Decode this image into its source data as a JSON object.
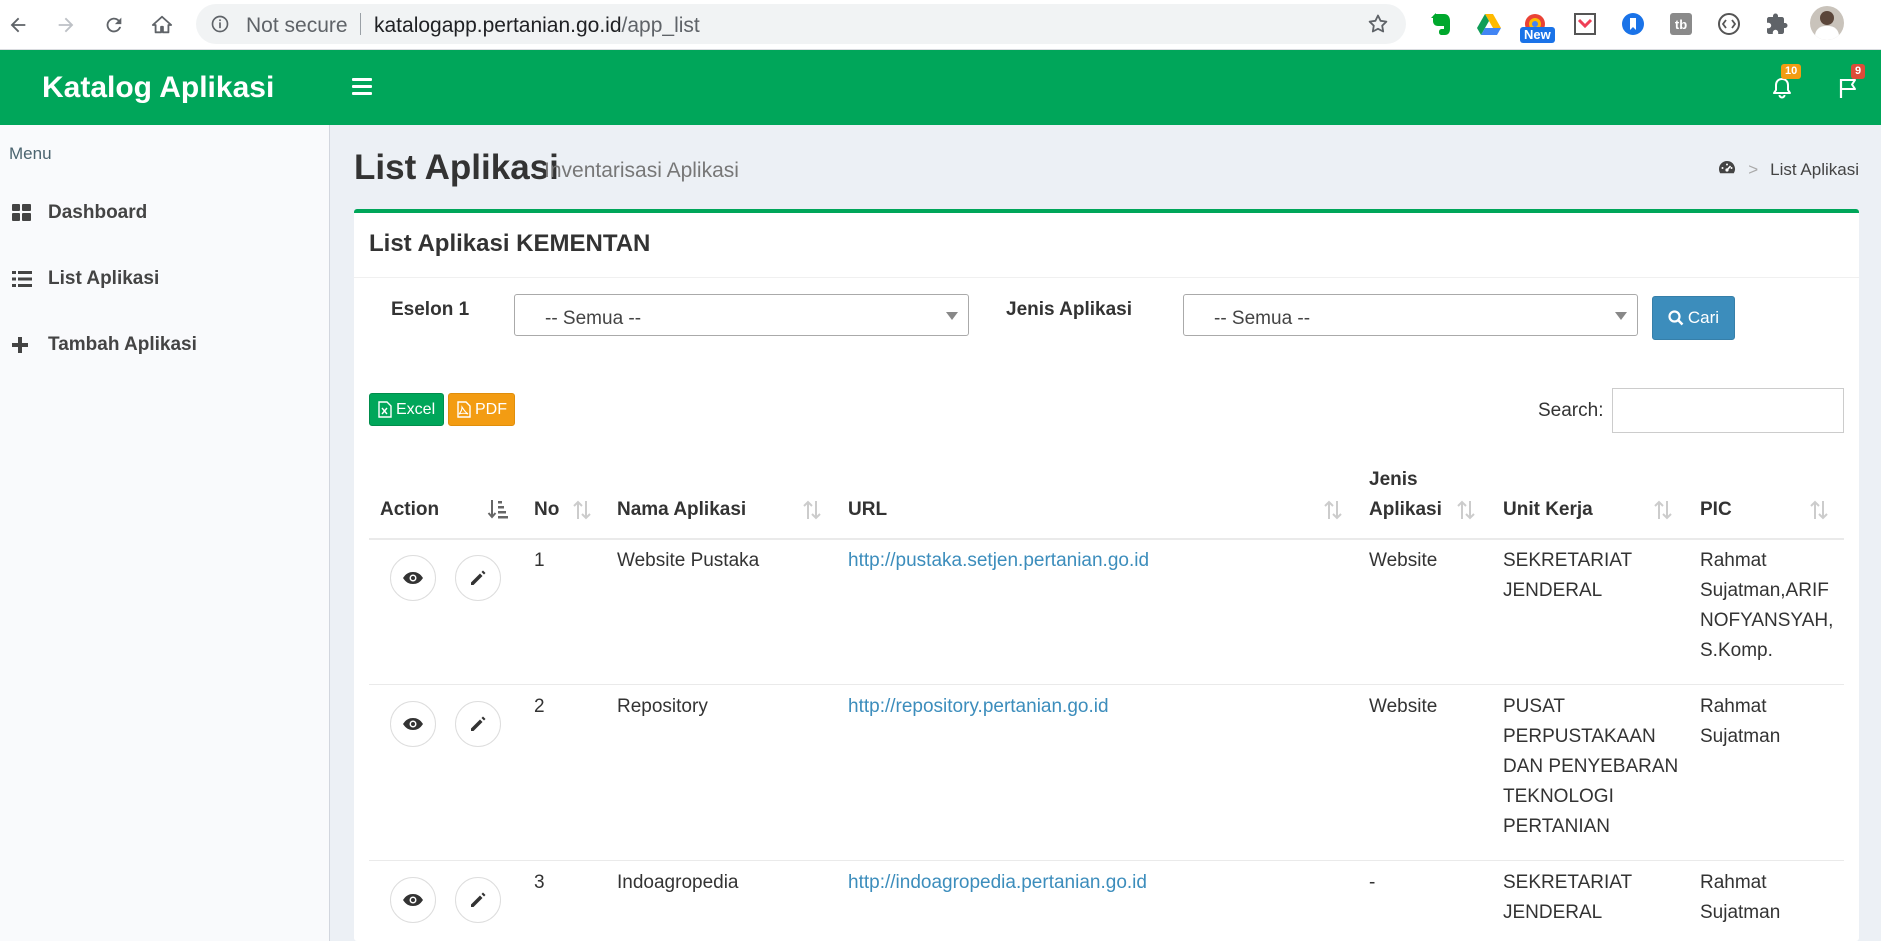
{
  "browser": {
    "security_text": "Not secure",
    "url_host": "katalogapp.pertanian.go.id",
    "url_path": "/app_list",
    "extension_badge": "New"
  },
  "header": {
    "app_title": "Katalog Aplikasi",
    "notifications_count": "10",
    "flags_count": "9",
    "brand_color": "#00a65a"
  },
  "sidebar": {
    "menu_header": "Menu",
    "items": [
      {
        "label": "Dashboard",
        "icon": "dashboard-icon"
      },
      {
        "label": "List Aplikasi",
        "icon": "list-icon"
      },
      {
        "label": "Tambah Aplikasi",
        "icon": "plus-icon"
      }
    ]
  },
  "content": {
    "title": "List Aplikasi",
    "subtitle": "Inventarisasi Aplikasi",
    "breadcrumb_current": "List Aplikasi"
  },
  "box": {
    "title": "List Aplikasi KEMENTAN",
    "filters": {
      "eselon_label": "Eselon 1",
      "eselon_value": "-- Semua --",
      "jenis_label": "Jenis Aplikasi",
      "jenis_value": "-- Semua --",
      "search_button": "Cari"
    },
    "export": {
      "excel": "Excel",
      "pdf": "PDF"
    },
    "search_label": "Search:",
    "search_value": ""
  },
  "table": {
    "columns": {
      "action": "Action",
      "no": "No",
      "nama": "Nama Aplikasi",
      "url": "URL",
      "jenis_1": "Jenis",
      "jenis_2": "Aplikasi",
      "unit": "Unit Kerja",
      "pic": "PIC"
    },
    "rows": [
      {
        "no": "1",
        "nama": "Website Pustaka",
        "url": "http://pustaka.setjen.pertanian.go.id",
        "jenis": "Website",
        "unit": [
          "SEKRETARIAT",
          "JENDERAL"
        ],
        "pic": [
          "Rahmat",
          "Sujatman,ARIF",
          "NOFYANSYAH,",
          "S.Komp."
        ]
      },
      {
        "no": "2",
        "nama": "Repository",
        "url": "http://repository.pertanian.go.id",
        "jenis": "Website",
        "unit": [
          "PUSAT",
          "PERPUSTAKAAN",
          "DAN PENYEBARAN",
          "TEKNOLOGI",
          "PERTANIAN"
        ],
        "pic": [
          "Rahmat",
          "Sujatman"
        ]
      },
      {
        "no": "3",
        "nama": "Indoagropedia",
        "url": "http://indoagropedia.pertanian.go.id",
        "jenis": "-",
        "unit": [
          "SEKRETARIAT",
          "JENDERAL"
        ],
        "pic": [
          "Rahmat",
          "Sujatman"
        ]
      }
    ]
  }
}
